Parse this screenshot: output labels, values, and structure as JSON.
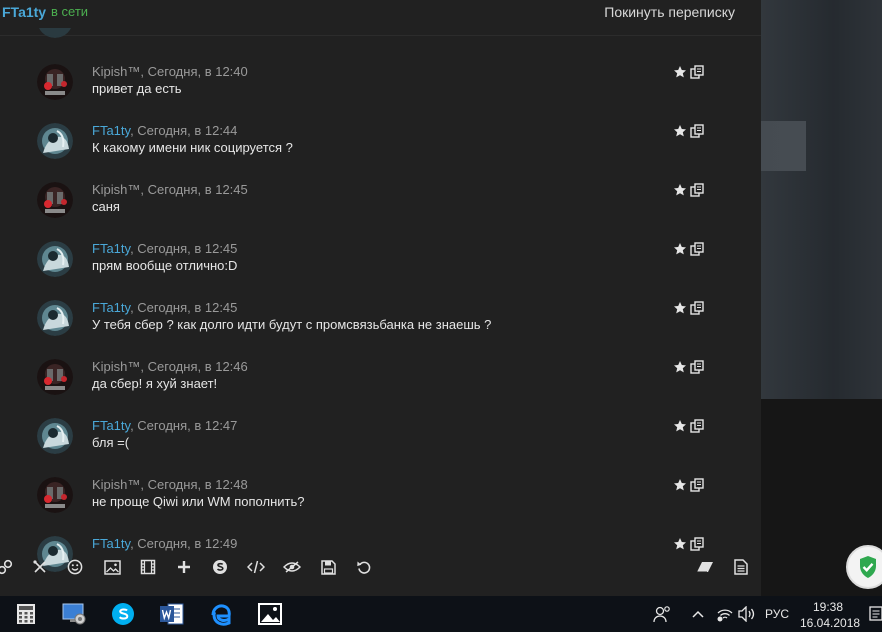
{
  "header": {
    "contact_name": "FTa1ty",
    "status": "в сети",
    "leave_label": "Покинуть переписку"
  },
  "messages": [
    {
      "author": "Kipish™",
      "sep": ", ",
      "time": "Сегодня, в 12:40",
      "text": "привет да есть",
      "kind": "k"
    },
    {
      "author": "FTa1ty",
      "sep": ", ",
      "time": "Сегодня, в 12:44",
      "text": "К какому имени ник социруется ?",
      "kind": "f"
    },
    {
      "author": "Kipish™",
      "sep": ", ",
      "time": "Сегодня, в 12:45",
      "text": "саня",
      "kind": "k"
    },
    {
      "author": "FTa1ty",
      "sep": ", ",
      "time": "Сегодня, в 12:45",
      "text": "прям вообще отлично:D",
      "kind": "f"
    },
    {
      "author": "FTa1ty",
      "sep": ", ",
      "time": "Сегодня, в 12:45",
      "text": "У тебя сбер ? как долго идти будут с промсвязьбанка не знаешь ?",
      "kind": "f"
    },
    {
      "author": "Kipish™",
      "sep": ", ",
      "time": "Сегодня, в 12:46",
      "text": "да сбер! я хуй знает!",
      "kind": "k"
    },
    {
      "author": "FTa1ty",
      "sep": ", ",
      "time": "Сегодня, в 12:47",
      "text": "бля =(",
      "kind": "f"
    },
    {
      "author": "Kipish™",
      "sep": ", ",
      "time": "Сегодня, в 12:48",
      "text": "не проще Qiwi или WM пополнить?",
      "kind": "k"
    },
    {
      "author": "FTa1ty",
      "sep": ", ",
      "time": "Сегодня, в 12:49",
      "text": "",
      "kind": "f"
    }
  ],
  "toolbar_icons": [
    "link-icon",
    "clear-format-icon",
    "smiley-icon",
    "image-icon",
    "video-icon",
    "plus-icon",
    "skype-icon",
    "code-icon",
    "spoiler-icon",
    "save-icon",
    "undo-icon",
    "eraser-icon",
    "document-icon"
  ],
  "taskbar": {
    "language": "РУС",
    "time": "19:38",
    "date": "16.04.2018"
  },
  "colors": {
    "accent_name": "#4aa8d8",
    "online": "#4caf50",
    "chat_bg": "#212121",
    "taskbar_bg": "#0d1117"
  }
}
